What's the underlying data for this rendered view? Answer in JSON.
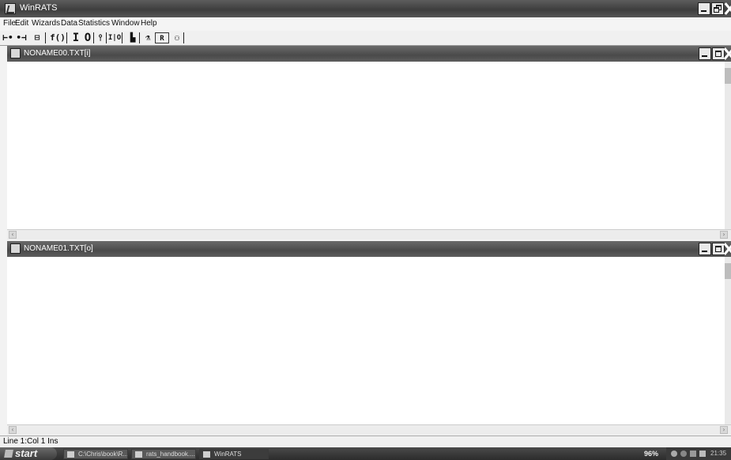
{
  "app": {
    "title": "WinRATS"
  },
  "menu": [
    "File",
    "Edit",
    "Wizards",
    "Data",
    "Statistics",
    "Window",
    "Help"
  ],
  "toolbar": {
    "buttons": [
      {
        "label": "⊢•",
        "name": "toolbar-run-button"
      },
      {
        "label": "•⊣",
        "name": "toolbar-stop-button"
      },
      {
        "label": "⊟",
        "name": "toolbar-print-button"
      },
      {
        "label": "f()",
        "name": "toolbar-function-button"
      },
      {
        "label": "I",
        "name": "toolbar-input-button"
      },
      {
        "label": "O",
        "name": "toolbar-output-button"
      },
      {
        "label": "⫯",
        "name": "toolbar-split-button"
      },
      {
        "label": "I|O",
        "name": "toolbar-io-button"
      },
      {
        "label": "▙",
        "name": "toolbar-graph-button"
      },
      {
        "label": "⚗",
        "name": "toolbar-wizard-button"
      },
      {
        "label": "R",
        "name": "toolbar-report-button"
      },
      {
        "label": "⚇",
        "name": "toolbar-series-button"
      }
    ]
  },
  "windows": [
    {
      "title": "NONAME00.TXT[i]"
    },
    {
      "title": "NONAME01.TXT[o]"
    }
  ],
  "status": {
    "text": "Line 1:Col 1  Ins"
  },
  "taskbar": {
    "start_label": "start",
    "tasks": [
      "C:\\Chris\\book\\R...",
      "rats_handbook....",
      "WinRATS"
    ],
    "zoom": "96%",
    "clock": "21:35"
  }
}
